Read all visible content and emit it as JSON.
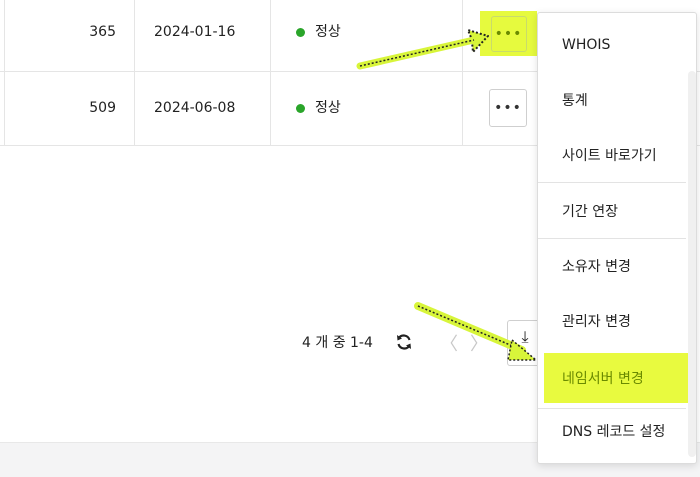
{
  "rows": [
    {
      "count": "365",
      "date": "2024-01-16",
      "status": "정상",
      "more_label": "•••"
    },
    {
      "count": "509",
      "date": "2024-06-08",
      "status": "정상",
      "more_label": "•••"
    }
  ],
  "pagination": {
    "info": "4 개 중 1-4",
    "prev": "〈",
    "next": "〉",
    "download": "⤓"
  },
  "menu": {
    "items": [
      {
        "label": "WHOIS"
      },
      {
        "label": "통계"
      },
      {
        "label": "사이트 바로가기"
      },
      {
        "label": "기간 연장"
      },
      {
        "label": "소유자 변경"
      },
      {
        "label": "관리자 변경"
      },
      {
        "label": "네임서버 변경"
      },
      {
        "label": "DNS 레코드 설정"
      }
    ]
  },
  "colors": {
    "highlight": "#e8fa3f",
    "status_ok": "#2aa52a"
  }
}
